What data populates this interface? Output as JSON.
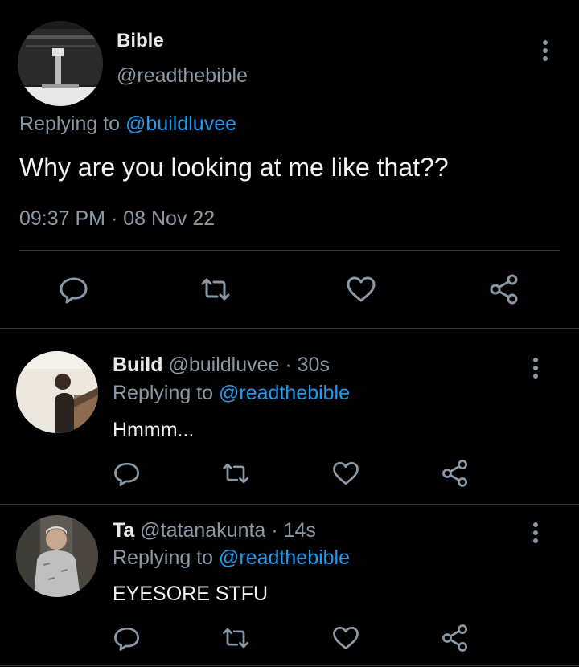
{
  "main_tweet": {
    "name": "Bible",
    "handle": "@readthebible",
    "replying_prefix": "Replying to ",
    "replying_to": "@buildluvee",
    "text": "Why are you looking at me like that??",
    "time": "09:37 PM",
    "separator": "·",
    "date": "08 Nov 22"
  },
  "replies": [
    {
      "name": "Build",
      "handle": "@buildluvee",
      "separator": "·",
      "age": "30s",
      "replying_prefix": "Replying to ",
      "replying_to": "@readthebible",
      "text": "Hmmm..."
    },
    {
      "name": "Ta",
      "handle": "@tatanakunta",
      "separator": "·",
      "age": "14s",
      "replying_prefix": "Replying to ",
      "replying_to": "@readthebible",
      "text": "EYESORE STFU"
    }
  ],
  "icons": {
    "reply": "reply-icon",
    "retweet": "retweet-icon",
    "like": "heart-icon",
    "share": "share-icon",
    "more": "more-vertical-icon"
  },
  "colors": {
    "background": "#000000",
    "text": "#e7e9ea",
    "secondary": "#8b98a5",
    "link": "#1d9bf0",
    "divider": "#2f3336"
  }
}
